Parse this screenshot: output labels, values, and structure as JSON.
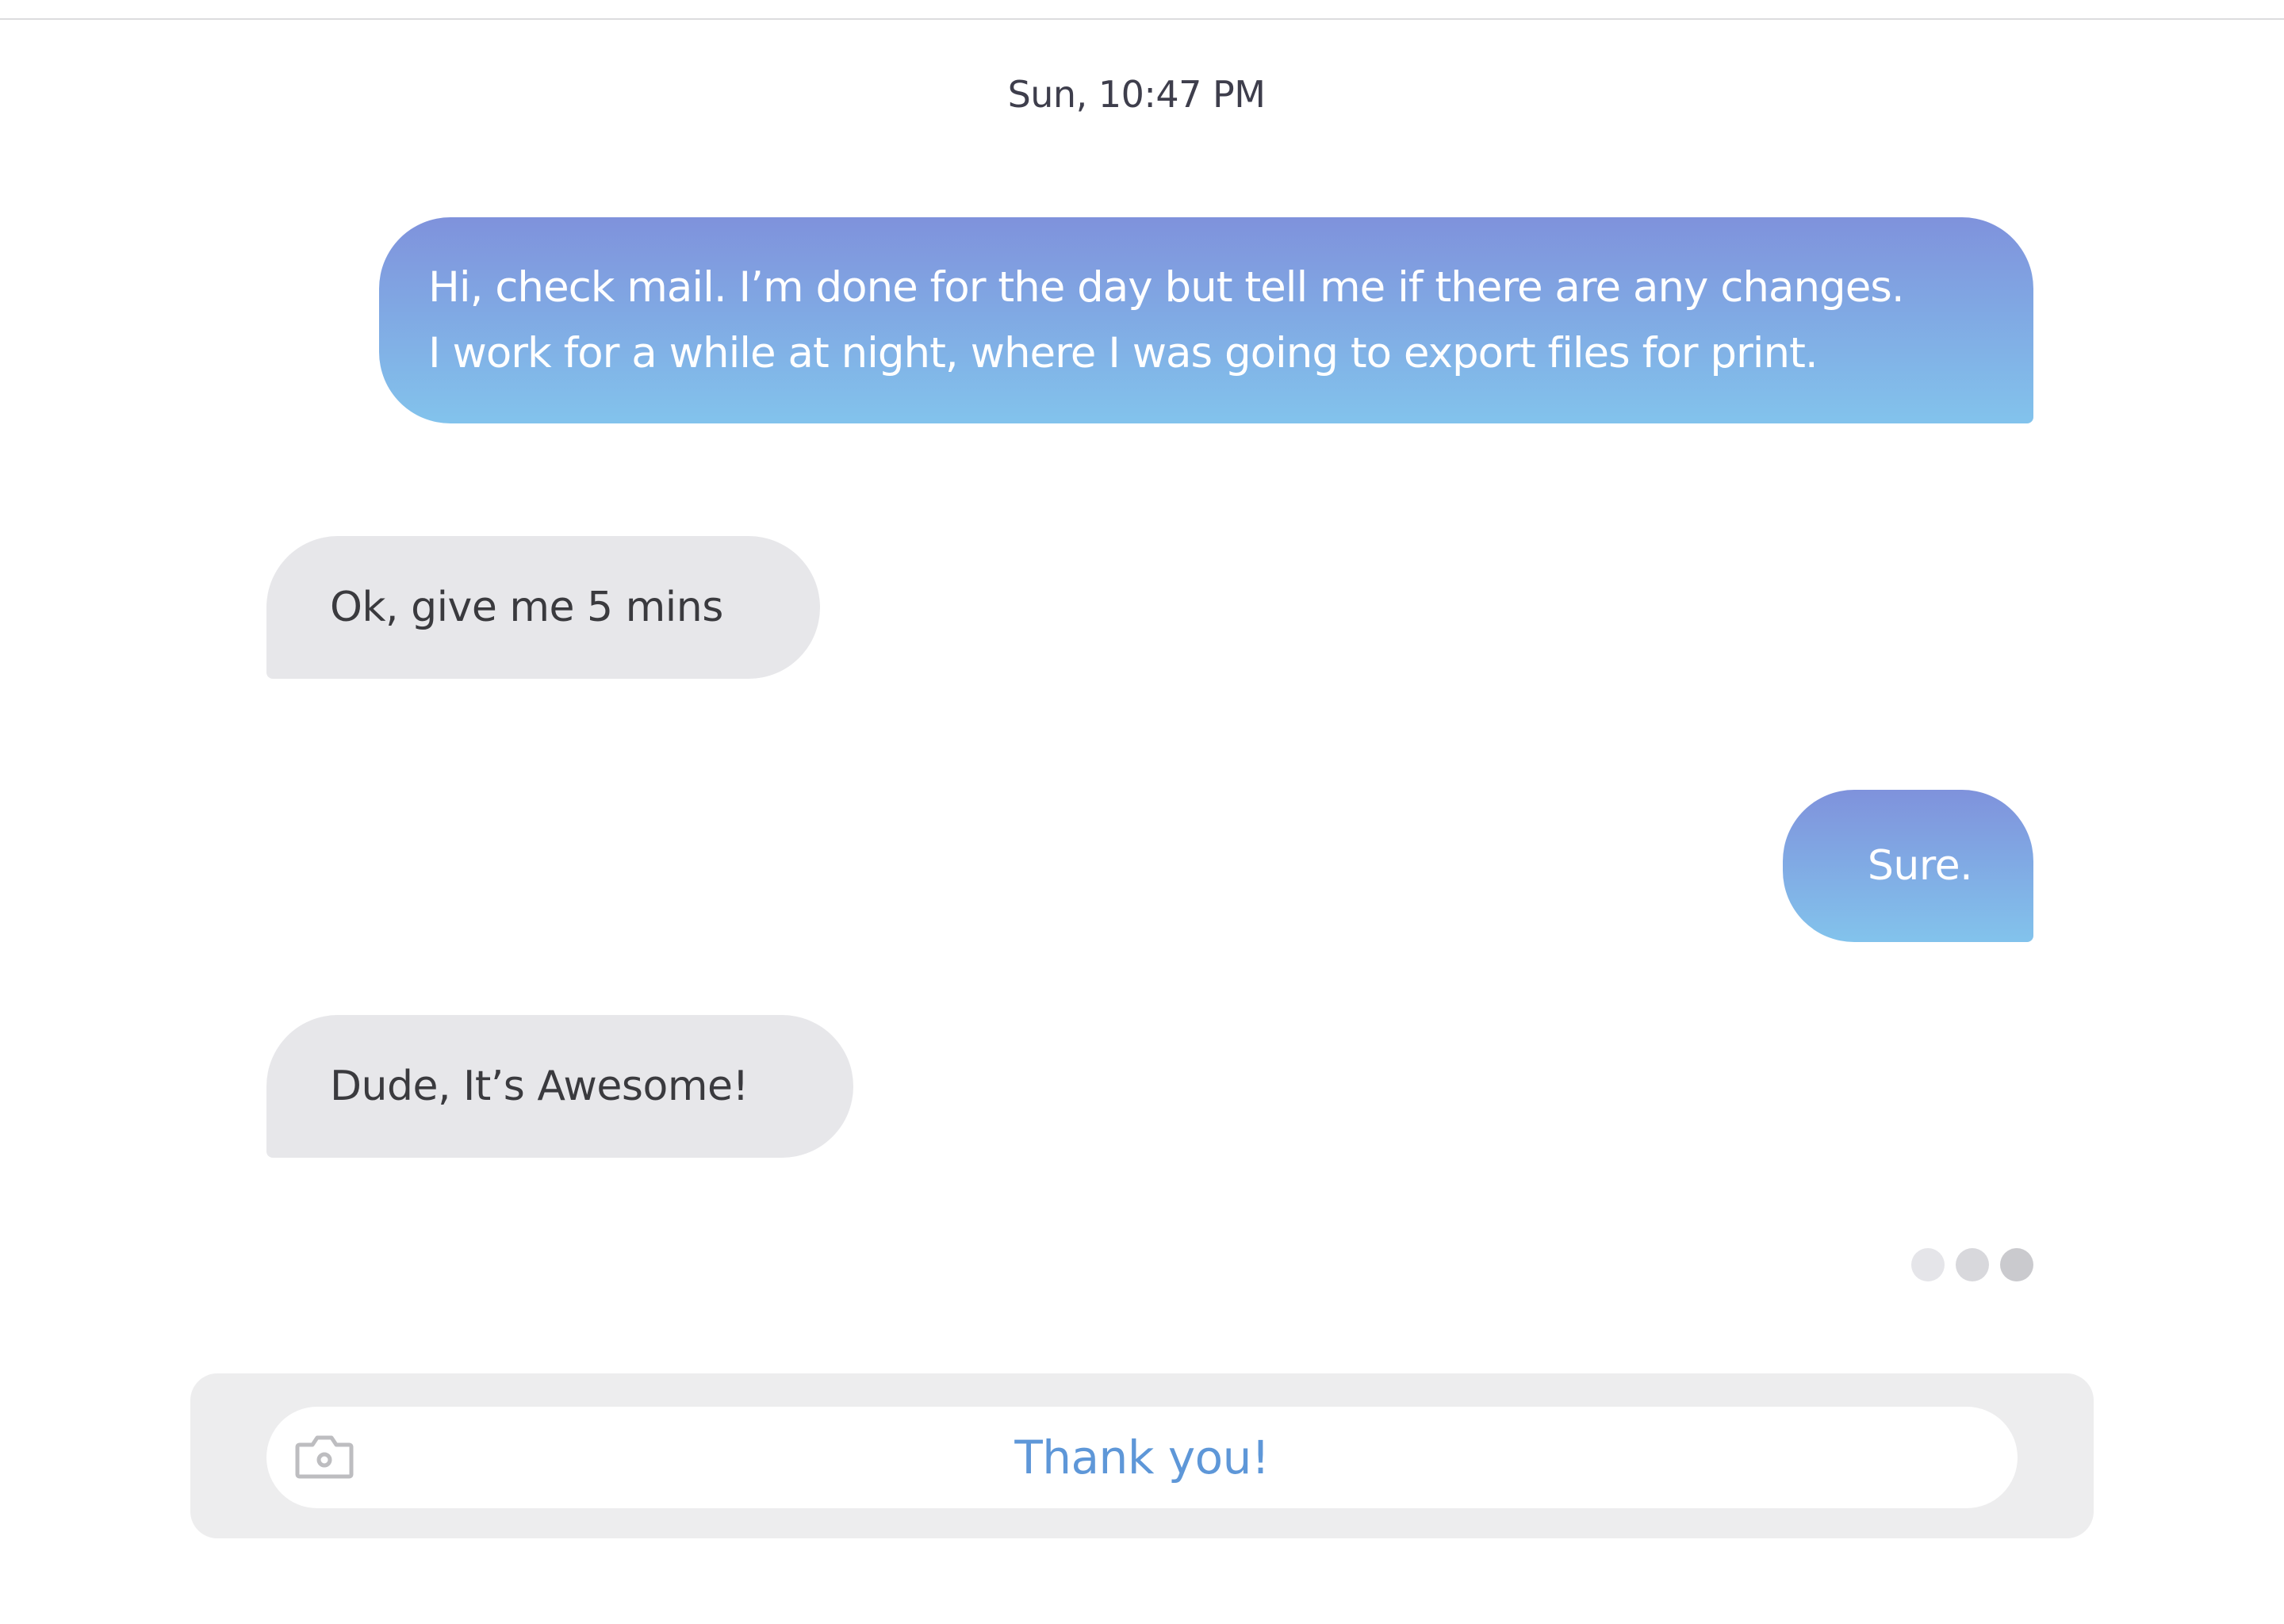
{
  "conversation": {
    "timestamp": "Sun, 10:47 PM",
    "messages": [
      {
        "direction": "outgoing",
        "lines": [
          "Hi, check mail. I’m done for the day but tell me if there are any changes.",
          "I work for a while at night, where I was going to export files for print."
        ]
      },
      {
        "direction": "incoming",
        "text": "Ok, give me 5 mins"
      },
      {
        "direction": "outgoing",
        "text": "Sure."
      },
      {
        "direction": "incoming",
        "text": "Dude, It’s Awesome!"
      }
    ],
    "typing_indicator": {
      "dots": 3
    }
  },
  "composer": {
    "camera_icon": "camera-icon",
    "input_value": "Thank you!"
  },
  "colors": {
    "outgoing_gradient_top": "#7f92dc",
    "outgoing_gradient_bottom": "#82c3ec",
    "incoming_bubble": "#e7e7ea",
    "input_text": "#5e97d8",
    "composer_bg": "#ededee"
  }
}
